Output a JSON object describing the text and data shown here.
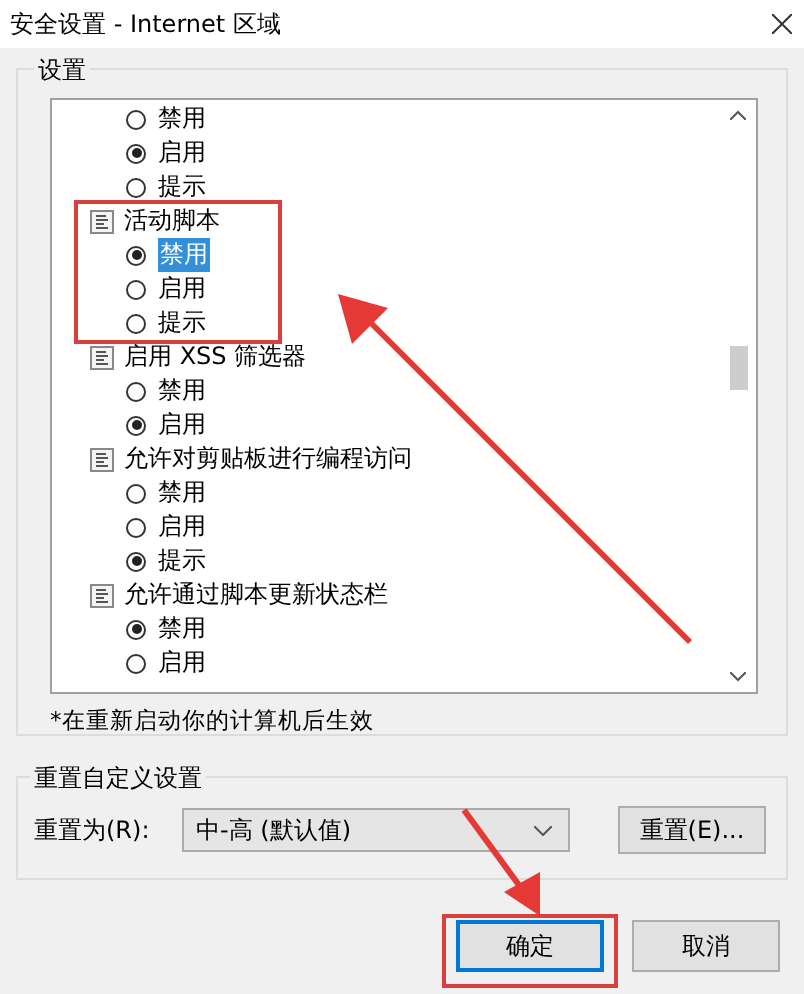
{
  "window": {
    "title": "安全设置 - Internet 区域"
  },
  "settings": {
    "label": "设置",
    "groups": [
      {
        "options": [
          {
            "label": "禁用",
            "selected": false,
            "highlighted": false
          },
          {
            "label": "启用",
            "selected": true,
            "highlighted": false
          },
          {
            "label": "提示",
            "selected": false,
            "highlighted": false
          }
        ]
      },
      {
        "title": "活动脚本",
        "annotated": true,
        "options": [
          {
            "label": "禁用",
            "selected": true,
            "highlighted": true
          },
          {
            "label": "启用",
            "selected": false,
            "highlighted": false
          },
          {
            "label": "提示",
            "selected": false,
            "highlighted": false
          }
        ]
      },
      {
        "title": "启用 XSS 筛选器",
        "options": [
          {
            "label": "禁用",
            "selected": false,
            "highlighted": false
          },
          {
            "label": "启用",
            "selected": true,
            "highlighted": false
          }
        ]
      },
      {
        "title": "允许对剪贴板进行编程访问",
        "options": [
          {
            "label": "禁用",
            "selected": false,
            "highlighted": false
          },
          {
            "label": "启用",
            "selected": false,
            "highlighted": false
          },
          {
            "label": "提示",
            "selected": true,
            "highlighted": false
          }
        ]
      },
      {
        "title": "允许通过脚本更新状态栏",
        "options": [
          {
            "label": "禁用",
            "selected": true,
            "highlighted": false
          },
          {
            "label": "启用",
            "selected": false,
            "highlighted": false
          }
        ]
      }
    ],
    "footnote": "*在重新启动你的计算机后生效"
  },
  "reset": {
    "label": "重置自定义设置",
    "field_label": "重置为(R):",
    "value": "中-高 (默认值)",
    "button": "重置(E)..."
  },
  "buttons": [
    {
      "label": "确定",
      "default": true,
      "annotated": true
    },
    {
      "label": "取消",
      "default": false
    }
  ]
}
